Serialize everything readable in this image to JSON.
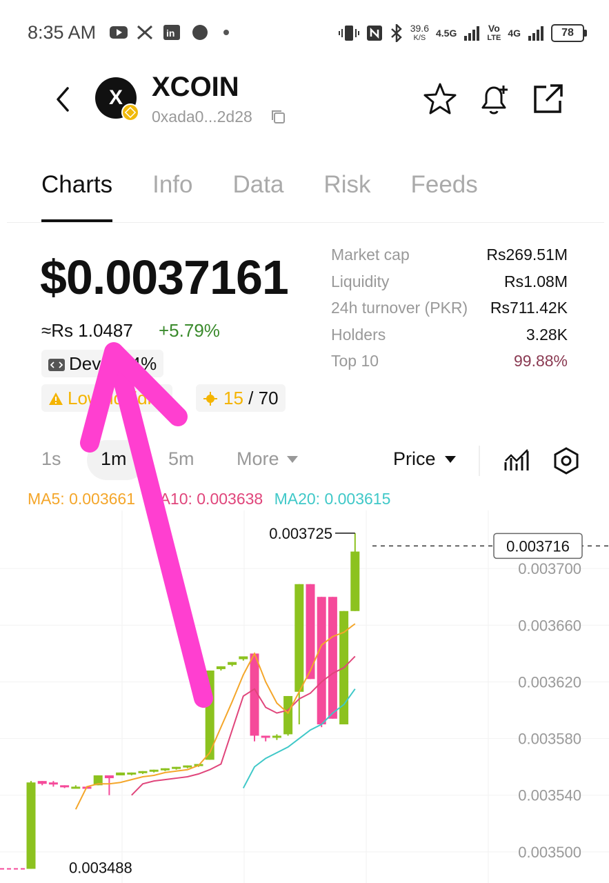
{
  "status": {
    "time": "8:35 AM",
    "net_speed_value": "39.6",
    "net_speed_unit": "K/S",
    "signal1": "4.5G",
    "volte_top": "Vo",
    "volte_bottom": "LTE",
    "signal2": "4G",
    "battery": "78"
  },
  "token": {
    "name": "XCOIN",
    "avatar_letter": "X",
    "address": "0xada0...2d28"
  },
  "tabs": [
    {
      "label": "Charts",
      "active": true
    },
    {
      "label": "Info",
      "active": false
    },
    {
      "label": "Data",
      "active": false
    },
    {
      "label": "Risk",
      "active": false
    },
    {
      "label": "Feeds",
      "active": false
    }
  ],
  "price": {
    "usd": "$0.0037161",
    "pkr": "≈Rs 1.0487",
    "change": "+5.79%"
  },
  "chips": {
    "dev": "Dev 2.44%",
    "liquidity": "Low liquidity",
    "score": "15",
    "score_total": "/ 70"
  },
  "stats": [
    {
      "label": "Market cap",
      "value": "Rs269.51M"
    },
    {
      "label": "Liquidity",
      "value": "Rs1.08M"
    },
    {
      "label": "24h turnover (PKR)",
      "value": "Rs711.42K"
    },
    {
      "label": "Holders",
      "value": "3.28K"
    },
    {
      "label": "Top 10",
      "value": "99.88%"
    }
  ],
  "colors": {
    "up": "#8cc21f",
    "down": "#f54a9a",
    "ma5": "#f4a62a",
    "ma10": "#e0457b",
    "ma20": "#3fc8c8",
    "top10": "#8a3a52",
    "arrow": "#ff3fd0"
  },
  "intervals": {
    "items": [
      "1s",
      "1m",
      "5m",
      "More"
    ],
    "active": "1m",
    "price_selector": "Price"
  },
  "ma": {
    "ma5": "MA5: 0.003661",
    "ma10": "MA10: 0.003638",
    "ma20": "MA20: 0.003615"
  },
  "chart_data": {
    "type": "candlestick",
    "y_ticks": [
      "0.003700",
      "0.003660",
      "0.003620",
      "0.003580",
      "0.003540",
      "0.003500"
    ],
    "ylim": [
      0.003478,
      0.003741
    ],
    "current_price_label": "0.003716",
    "current_price": 0.003716,
    "high_label": "0.003725",
    "low_label": "0.003488",
    "candles": [
      {
        "o": 0.003488,
        "c": 0.003549,
        "h": 0.00355,
        "l": 0.003488,
        "dir": "up"
      },
      {
        "o": 0.00355,
        "c": 0.003548,
        "h": 0.00355,
        "l": 0.003547,
        "dir": "down"
      },
      {
        "o": 0.003549,
        "c": 0.003548,
        "h": 0.00355,
        "l": 0.003546,
        "dir": "down"
      },
      {
        "o": 0.003547,
        "c": 0.003546,
        "h": 0.003547,
        "l": 0.003545,
        "dir": "down"
      },
      {
        "o": 0.003545,
        "c": 0.003546,
        "h": 0.003547,
        "l": 0.003545,
        "dir": "up"
      },
      {
        "o": 0.003546,
        "c": 0.003545,
        "h": 0.003546,
        "l": 0.003545,
        "dir": "down"
      },
      {
        "o": 0.003547,
        "c": 0.003554,
        "h": 0.003554,
        "l": 0.003547,
        "dir": "up"
      },
      {
        "o": 0.003554,
        "c": 0.003552,
        "h": 0.003554,
        "l": 0.00354,
        "dir": "down"
      },
      {
        "o": 0.003554,
        "c": 0.003556,
        "h": 0.003556,
        "l": 0.003554,
        "dir": "up"
      },
      {
        "o": 0.003555,
        "c": 0.003556,
        "h": 0.003556,
        "l": 0.003554,
        "dir": "up"
      },
      {
        "o": 0.003556,
        "c": 0.003557,
        "h": 0.003557,
        "l": 0.003555,
        "dir": "up"
      },
      {
        "o": 0.003557,
        "c": 0.003558,
        "h": 0.003558,
        "l": 0.003556,
        "dir": "up"
      },
      {
        "o": 0.003558,
        "c": 0.003559,
        "h": 0.003559,
        "l": 0.003557,
        "dir": "up"
      },
      {
        "o": 0.003559,
        "c": 0.00356,
        "h": 0.00356,
        "l": 0.003558,
        "dir": "up"
      },
      {
        "o": 0.00356,
        "c": 0.003561,
        "h": 0.003561,
        "l": 0.003559,
        "dir": "up"
      },
      {
        "o": 0.003561,
        "c": 0.003562,
        "h": 0.003562,
        "l": 0.00356,
        "dir": "up"
      },
      {
        "o": 0.003565,
        "c": 0.003628,
        "h": 0.003628,
        "l": 0.003565,
        "dir": "up"
      },
      {
        "o": 0.003629,
        "c": 0.003631,
        "h": 0.003631,
        "l": 0.003628,
        "dir": "up"
      },
      {
        "o": 0.003632,
        "c": 0.003634,
        "h": 0.003634,
        "l": 0.003631,
        "dir": "up"
      },
      {
        "o": 0.003636,
        "c": 0.003638,
        "h": 0.003638,
        "l": 0.003635,
        "dir": "up"
      },
      {
        "o": 0.00364,
        "c": 0.003582,
        "h": 0.00364,
        "l": 0.003578,
        "dir": "down"
      },
      {
        "o": 0.003582,
        "c": 0.003581,
        "h": 0.003582,
        "l": 0.003578,
        "dir": "down"
      },
      {
        "o": 0.003581,
        "c": 0.003582,
        "h": 0.003583,
        "l": 0.003579,
        "dir": "up"
      },
      {
        "o": 0.003583,
        "c": 0.00361,
        "h": 0.00361,
        "l": 0.003582,
        "dir": "up"
      },
      {
        "o": 0.003613,
        "c": 0.003689,
        "h": 0.003689,
        "l": 0.00359,
        "dir": "up"
      },
      {
        "o": 0.003689,
        "c": 0.003622,
        "h": 0.003689,
        "l": 0.003622,
        "dir": "down"
      },
      {
        "o": 0.00368,
        "c": 0.00359,
        "h": 0.00368,
        "l": 0.003588,
        "dir": "down"
      },
      {
        "o": 0.00368,
        "c": 0.003594,
        "h": 0.00368,
        "l": 0.003594,
        "dir": "down"
      },
      {
        "o": 0.00359,
        "c": 0.00367,
        "h": 0.00367,
        "l": 0.00359,
        "dir": "up"
      },
      {
        "o": 0.00367,
        "c": 0.003712,
        "h": 0.003725,
        "l": 0.00367,
        "dir": "up"
      }
    ],
    "ma5": [
      null,
      null,
      null,
      null,
      0.00353,
      0.003546,
      0.003548,
      0.003548,
      0.003549,
      0.003551,
      0.003553,
      0.003554,
      0.003556,
      0.003557,
      0.003558,
      0.003561,
      0.00357,
      0.003588,
      0.003606,
      0.003625,
      0.00364,
      0.00362,
      0.003605,
      0.003598,
      0.003613,
      0.003628,
      0.003646,
      0.003652,
      0.003655,
      0.003661
    ],
    "ma10": [
      null,
      null,
      null,
      null,
      null,
      null,
      null,
      null,
      null,
      0.00354,
      0.003548,
      0.00355,
      0.003551,
      0.003552,
      0.003553,
      0.003555,
      0.003558,
      0.003562,
      0.003586,
      0.00361,
      0.003615,
      0.003602,
      0.003598,
      0.0036,
      0.003608,
      0.003612,
      0.00362,
      0.003626,
      0.00363,
      0.003638
    ],
    "ma20": [
      null,
      null,
      null,
      null,
      null,
      null,
      null,
      null,
      null,
      null,
      null,
      null,
      null,
      null,
      null,
      null,
      null,
      null,
      null,
      0.003545,
      0.00356,
      0.003566,
      0.00357,
      0.003574,
      0.00358,
      0.003586,
      0.00359,
      0.003598,
      0.003604,
      0.003615
    ]
  }
}
